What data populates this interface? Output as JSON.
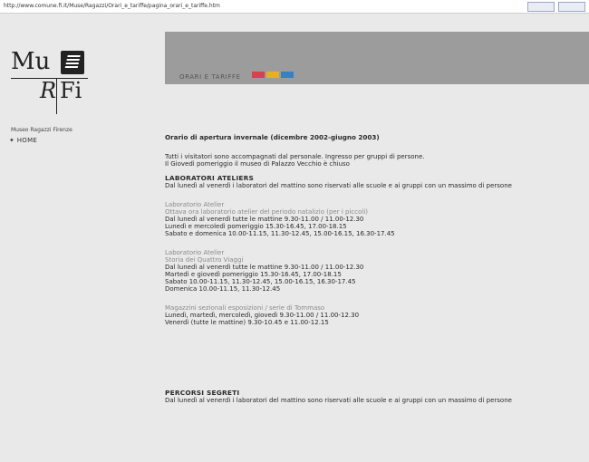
{
  "browser": {
    "address": "http://www.comune.fi.it/Muse/Ragazzi/Orari_e_tariffe/pagina_orari_e_tariffe.htm"
  },
  "logo": {
    "line1": "Mu",
    "r": "R",
    "fi": "Fi",
    "caption": "Museo Ragazzi Firenze"
  },
  "nav": {
    "home": "✦ HOME"
  },
  "header": {
    "section_label": "ORARI E TARIFFE",
    "swatch_colors": [
      "#d9414b",
      "#e8b020",
      "#3a7fc2"
    ]
  },
  "content": {
    "title": "Orario di apertura invernale (dicembre 2002-giugno 2003)",
    "intro": [
      "Tutti i visitatori sono accompagnati dal personale. Ingresso per gruppi di persone.",
      "Il Giovedì pomeriggio il museo di Palazzo Vecchio è chiuso"
    ],
    "lab_title": "LABORATORI ATELIERS",
    "lab_desc": "Dal lunedì al venerdì i laboratori del mattino sono riservati alle scuole e ai gruppi con un massimo di persone",
    "block1": {
      "label": "Laboratorio Atelier",
      "subtitle": "Ottava ora laboratorio atelier del periodo natalizio (per i piccoli)",
      "lines": [
        "Dal lunedì al venerdì tutte le mattine 9.30-11.00 / 11.00-12.30",
        "Lunedì e mercoledì pomeriggio 15.30-16.45, 17.00-18.15",
        "Sabato e domenica 10.00-11.15, 11.30-12.45, 15.00-16.15, 16.30-17.45"
      ]
    },
    "block2": {
      "label": "Laboratorio Atelier",
      "subtitle": "Storia dei Quattro Viaggi",
      "lines": [
        "Dal lunedì al venerdì tutte le mattine 9.30-11.00 / 11.00-12.30",
        "Martedì e giovedì pomeriggio 15.30-16.45, 17.00-18.15",
        "Sabato 10.00-11.15, 11.30-12.45, 15.00-16.15, 16.30-17.45",
        "Domenica 10.00-11.15, 11.30-12.45"
      ]
    },
    "block3": {
      "subtitle": "Magazzini sezionali esposizioni / serie di Tommaso",
      "lines": [
        "Lunedì, martedì, mercoledì, giovedì 9.30-11.00 / 11.00-12.30",
        "Venerdì (tutte le mattine) 9.30-10.45 e 11.00-12.15"
      ]
    },
    "percorsi_title": "PERCORSI SEGRETI",
    "percorsi_desc": "Dal lunedì al venerdì i laboratori del mattino sono riservati alle scuole e ai gruppi con un massimo di persone"
  }
}
